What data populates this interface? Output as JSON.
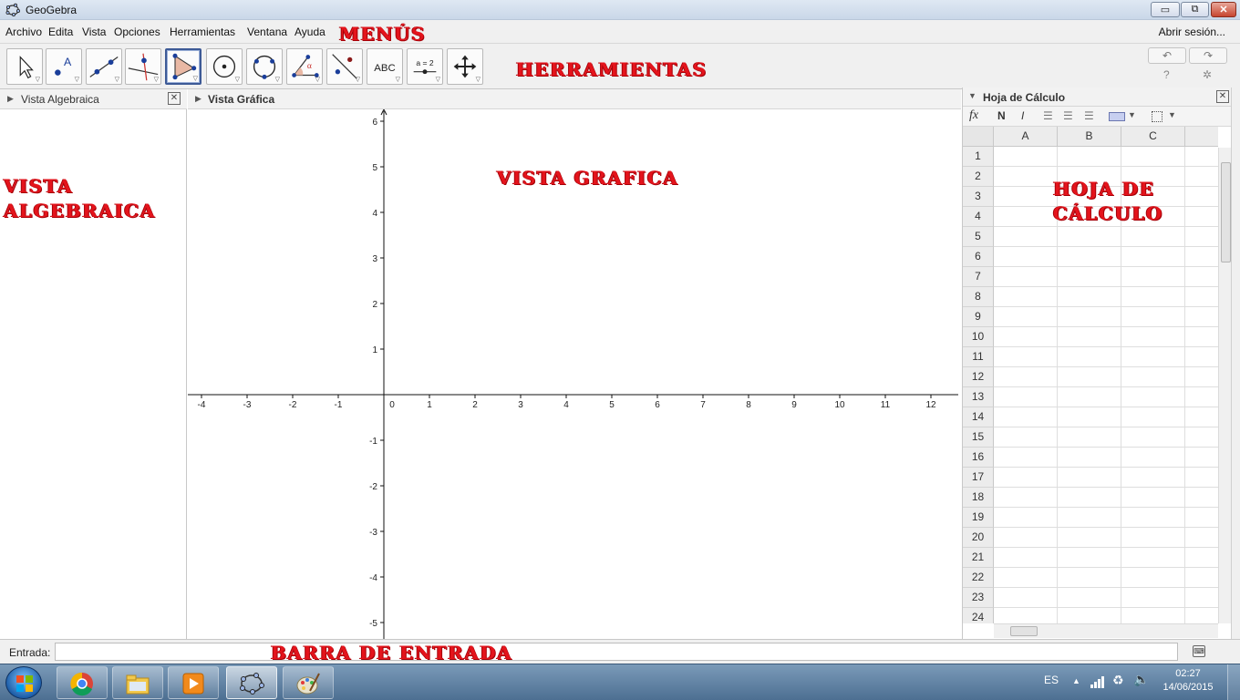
{
  "window": {
    "title": "GeoGebra",
    "buttons": {
      "minimize": "▭",
      "maximize": "⧉",
      "close": "✕"
    }
  },
  "menubar": {
    "items": [
      "Archivo",
      "Edita",
      "Vista",
      "Opciones",
      "Herramientas",
      "Ventana",
      "Ayuda"
    ],
    "login": "Abrir sesión..."
  },
  "toolbar": {
    "tools": [
      {
        "name": "move-tool-icon"
      },
      {
        "name": "point-tool-icon",
        "label": "A"
      },
      {
        "name": "line-tool-icon"
      },
      {
        "name": "perpendicular-line-tool-icon"
      },
      {
        "name": "polygon-tool-icon",
        "active": true
      },
      {
        "name": "circle-center-point-tool-icon"
      },
      {
        "name": "circle-three-points-tool-icon"
      },
      {
        "name": "angle-tool-icon",
        "label": "α"
      },
      {
        "name": "reflect-tool-icon"
      },
      {
        "name": "text-tool-icon",
        "label": "ABC"
      },
      {
        "name": "slider-tool-icon",
        "label": "a = 2"
      },
      {
        "name": "move-graphics-view-tool-icon"
      }
    ],
    "undo": "↶",
    "redo": "↷",
    "help": "?",
    "settings": "✲"
  },
  "algebra_view": {
    "title": "Vista Algebraica"
  },
  "graphics_view": {
    "title": "Vista Gráfica",
    "x_ticks": [
      -4,
      -3,
      -2,
      -1,
      0,
      1,
      2,
      3,
      4,
      5,
      6,
      7,
      8,
      9,
      10,
      11,
      12
    ],
    "y_ticks": [
      6,
      5,
      4,
      3,
      2,
      1,
      -1,
      -2,
      -3,
      -4,
      -5
    ]
  },
  "spreadsheet_view": {
    "title": "Hoja de Cálculo",
    "toolbar": {
      "fx": "fx",
      "bold": "N",
      "italic": "I"
    },
    "columns": [
      "A",
      "B",
      "C"
    ],
    "rows": [
      "1",
      "2",
      "3",
      "4",
      "5",
      "6",
      "7",
      "8",
      "9",
      "10",
      "11",
      "12",
      "13",
      "14",
      "15",
      "16",
      "17",
      "18",
      "19",
      "20",
      "21",
      "22",
      "23",
      "24"
    ]
  },
  "input_bar": {
    "label": "Entrada:",
    "value": "",
    "placeholder": ""
  },
  "annotations": {
    "menus": "MENÚS",
    "tools": "HERRAMIENTAS",
    "algebraic_line1": "VISTA",
    "algebraic_line2": "ALGEBRAICA",
    "graphic": "VISTA GRAFICA",
    "sheet_line1": "HOJA DE",
    "sheet_line2": "CÁLCULO",
    "input_bar": "BARRA DE ENTRADA"
  },
  "taskbar": {
    "apps": [
      "chrome-icon",
      "file-explorer-icon",
      "media-player-icon",
      "geogebra-icon",
      "paint-icon"
    ],
    "language": "ES",
    "time": "02:27",
    "date": "14/06/2015"
  }
}
